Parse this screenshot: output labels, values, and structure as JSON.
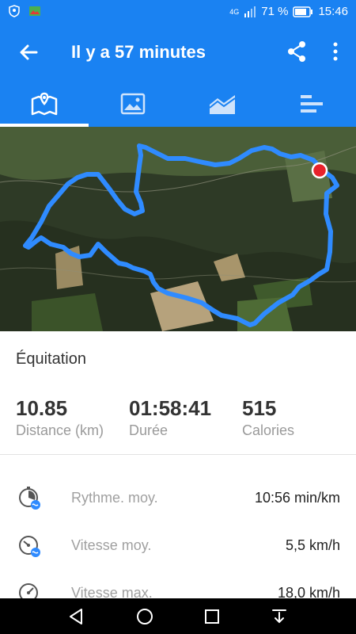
{
  "status_bar": {
    "network": "4G",
    "battery": "71 %",
    "time": "15:46"
  },
  "app_bar": {
    "title": "Il y a 57 minutes"
  },
  "tabs": [
    {
      "name": "map-icon",
      "active": true
    },
    {
      "name": "photo-icon",
      "active": false
    },
    {
      "name": "chart-icon",
      "active": false
    },
    {
      "name": "list-icon",
      "active": false
    }
  ],
  "activity": {
    "type": "Équitation"
  },
  "summary": {
    "distance_value": "10.85",
    "distance_label": "Distance (km)",
    "duration_value": "01:58:41",
    "duration_label": "Durée",
    "calories_value": "515",
    "calories_label": "Calories"
  },
  "details": [
    {
      "label": "Rythme. moy.",
      "value": "10:56 min/km",
      "icon": "pace-icon"
    },
    {
      "label": "Vitesse moy.",
      "value": "5,5 km/h",
      "icon": "speedometer-icon"
    },
    {
      "label": "Vitesse max.",
      "value": "18,0 km/h",
      "icon": "speedometer-max-icon"
    }
  ],
  "colors": {
    "primary": "#1a82f2",
    "route": "#2f8bff",
    "end_marker": "#e8222b"
  }
}
